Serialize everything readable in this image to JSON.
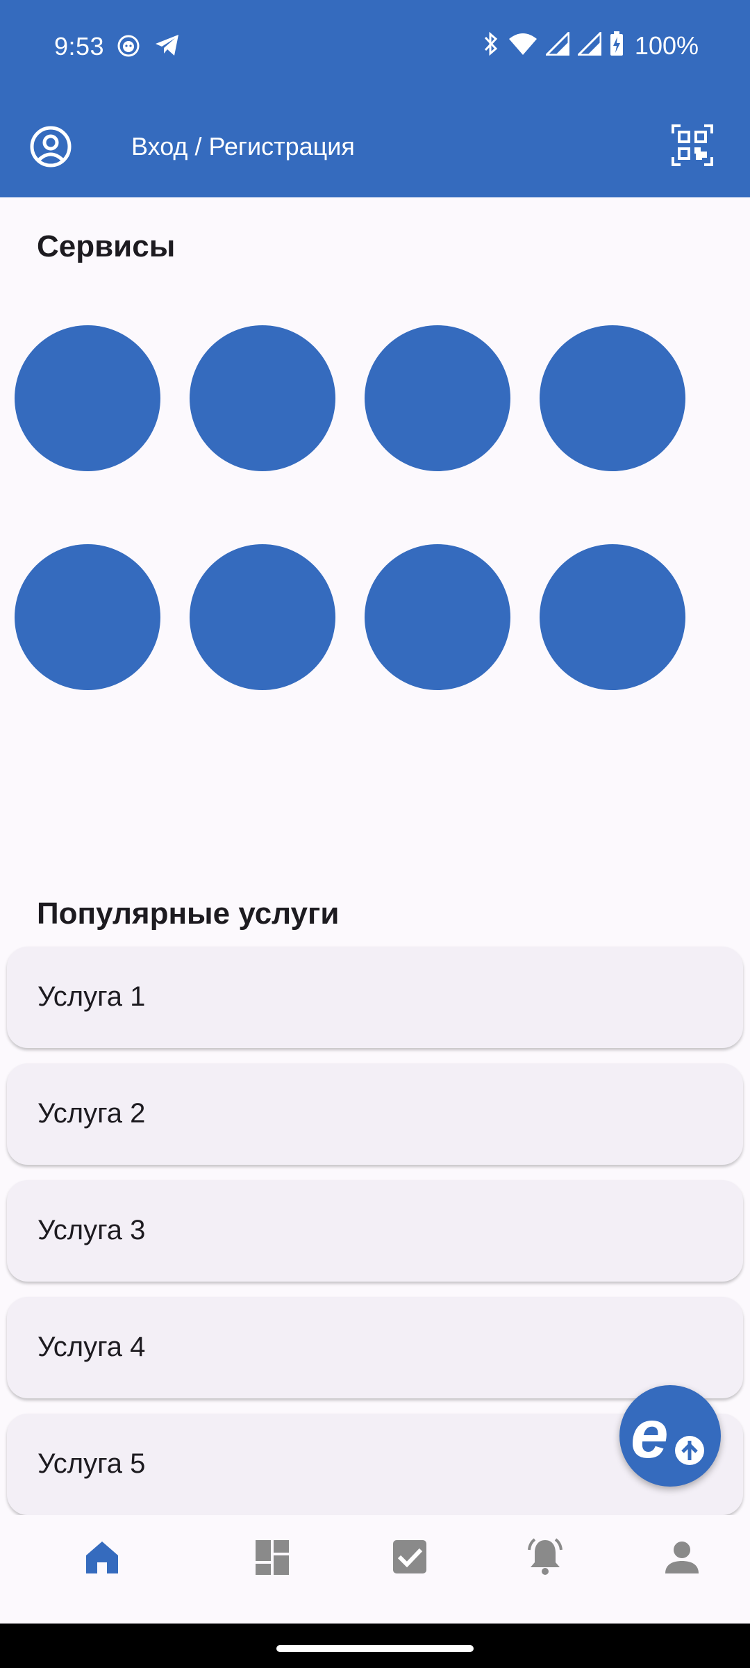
{
  "status_bar": {
    "time": "9:53",
    "battery": "100%",
    "icons": [
      "cat-notification-icon",
      "telegram-icon",
      "bluetooth-icon",
      "wifi-icon",
      "signal-icon",
      "signal-icon",
      "battery-charging-icon"
    ]
  },
  "app_bar": {
    "login_label": "Вход / Регистрация",
    "account_icon": "account-circle-icon",
    "qr_icon": "qr-code-scanner-icon"
  },
  "services": {
    "title": "Сервисы",
    "count": 8
  },
  "popular": {
    "title": "Популярные услуги",
    "items": [
      "Услуга 1",
      "Услуга 2",
      "Услуга 3",
      "Услуга 4",
      "Услуга 5"
    ]
  },
  "fab": {
    "icon": "e-logo-icon"
  },
  "bottom_nav": {
    "items": [
      "home-icon",
      "dashboard-icon",
      "checkbox-icon",
      "notifications-icon",
      "person-icon"
    ],
    "active_index": 0
  },
  "colors": {
    "primary": "#356bbe",
    "background": "#fcf9fd",
    "card": "#f3eff6",
    "nav_inactive": "#8a8a8a"
  }
}
